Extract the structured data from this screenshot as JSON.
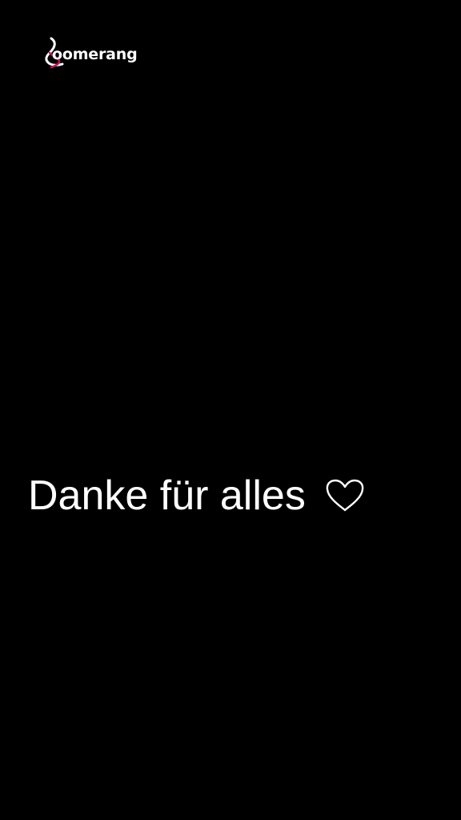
{
  "app": {
    "logo_text": "oomerang",
    "logo_icon": "boomerang-b-icon",
    "colors": {
      "background": "#000000",
      "text": "#ffffff",
      "logo_accent": "#c2185b"
    }
  },
  "story": {
    "caption": "Danke für alles",
    "caption_icon": "heart-outline-icon"
  }
}
